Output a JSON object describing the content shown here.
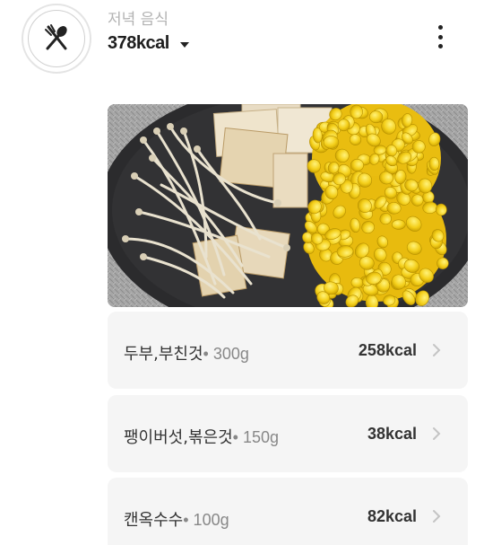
{
  "meal": {
    "title": "저녁 음식",
    "total_kcal": "378kcal",
    "icon": "fork-spoon-icon"
  },
  "photo": {
    "description_icon": "food-photo"
  },
  "items": [
    {
      "name": "두부,부친것",
      "amount": "• 300g",
      "kcal": "258kcal"
    },
    {
      "name": "팽이버섯,볶은것",
      "amount": "• 150g",
      "kcal": "38kcal"
    },
    {
      "name": "캔옥수수",
      "amount": "• 100g",
      "kcal": "82kcal"
    }
  ],
  "colors": {
    "card_bg": "#f5f5f5",
    "corn": "#f3cf1d",
    "plate": "#2a2a2c"
  }
}
